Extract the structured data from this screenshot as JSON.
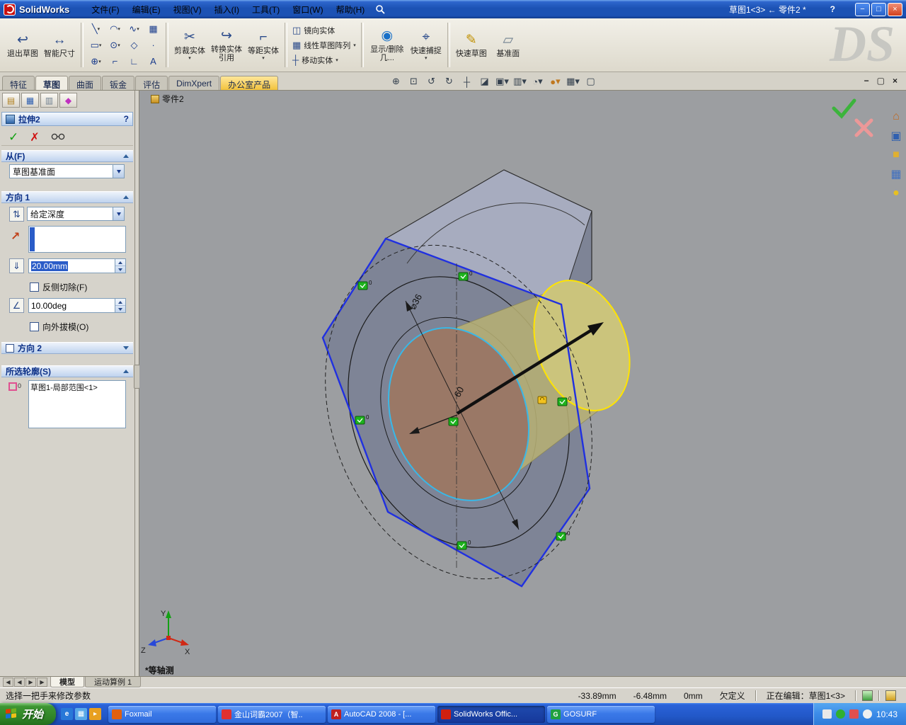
{
  "watermark": "DS",
  "titlebar": {
    "app_name": "SolidWorks",
    "menus": [
      "文件(F)",
      "编辑(E)",
      "视图(V)",
      "插入(I)",
      "工具(T)",
      "窗口(W)",
      "帮助(H)"
    ],
    "doc_title": "草图1<3> ← 零件2 *",
    "help": "?"
  },
  "ribbon": {
    "exit_sketch": "退出草图",
    "smart_dimension": "智能尺寸",
    "trim_entities": "剪裁实体",
    "convert_entities": "转换实体引用",
    "offset_entities": "等距实体",
    "mirror_entities": "镜向实体",
    "linear_sketch_pattern": "线性草图阵列",
    "move_entities": "移动实体",
    "display_delete_relations": "显示/删除几...",
    "quick_snaps": "快速捕捉",
    "rapid_sketch": "快速草图",
    "plane": "基准面"
  },
  "command_tabs": [
    "特征",
    "草图",
    "曲面",
    "钣金",
    "评估",
    "DimXpert",
    "办公室产品"
  ],
  "property_manager": {
    "title": "拉伸2",
    "help": "?",
    "from": {
      "header": "从(F)",
      "value": "草图基准面"
    },
    "direction1": {
      "header": "方向 1",
      "end_condition": "给定深度",
      "depth": "20.00mm",
      "flip_side_to_cut": "反侧切除(F)",
      "draft_angle": "10.00deg",
      "draft_outward": "向外拔模(O)"
    },
    "direction2": {
      "header": "方向 2"
    },
    "selected_contours": {
      "header": "所选轮廓(S)",
      "items": [
        "草图1-局部范围<1>"
      ]
    }
  },
  "viewport": {
    "document_label": "零件2",
    "view_orientation": "*等轴测",
    "dim_diameter": "⌀36",
    "dim_value": "60",
    "triad": {
      "x": "X",
      "y": "Y",
      "z": "Z"
    }
  },
  "document_tabs": [
    "模型",
    "运动算例 1"
  ],
  "status_bar": {
    "hint": "选择一把手来修改参数",
    "coord_x": "-33.89mm",
    "coord_y": "-6.48mm",
    "coord_z": "0mm",
    "definition_state": "欠定义",
    "editing": "正在编辑：草图1<3>"
  },
  "taskbar": {
    "start_label": "开始",
    "tasks": [
      "Foxmail",
      "金山词霸2007（智..",
      "AutoCAD 2008 - [...",
      "SolidWorks Offic...",
      "GOSURF"
    ],
    "clock": "10:43"
  }
}
